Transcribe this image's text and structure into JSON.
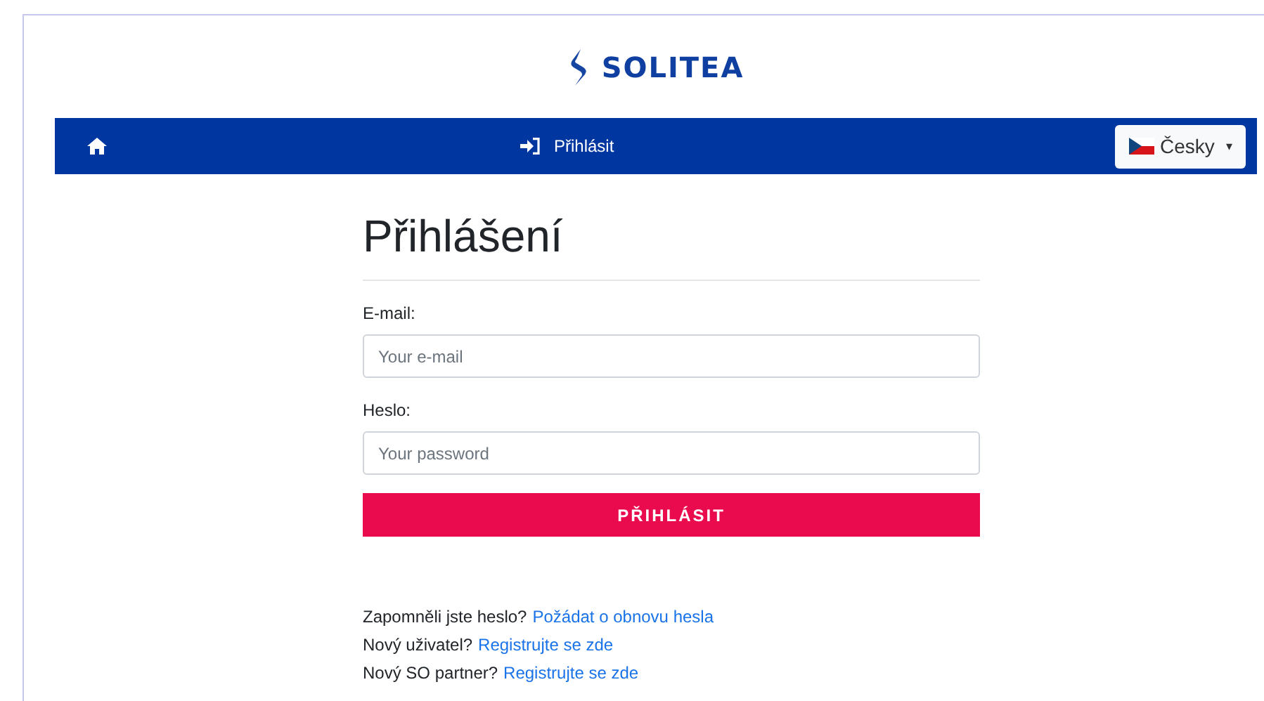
{
  "header": {
    "logo_text": "SOLITEA"
  },
  "navbar": {
    "login_link": "Přihlásit",
    "language": {
      "label": "Česky",
      "caret": "▾"
    }
  },
  "form": {
    "title": "Přihlášení",
    "fields": [
      {
        "label": "E-mail:",
        "placeholder": "Your e-mail"
      },
      {
        "label": "Heslo:",
        "placeholder": "Your password"
      }
    ],
    "submit": "PŘIHLÁSIT"
  },
  "links": [
    {
      "text": "Zapomněli jste heslo?",
      "link": "Požádat o obnovu hesla"
    },
    {
      "text": "Nový uživatel?",
      "link": "Registrujte se zde"
    },
    {
      "text": "Nový SO partner?",
      "link": "Registrujte se zde"
    }
  ]
}
